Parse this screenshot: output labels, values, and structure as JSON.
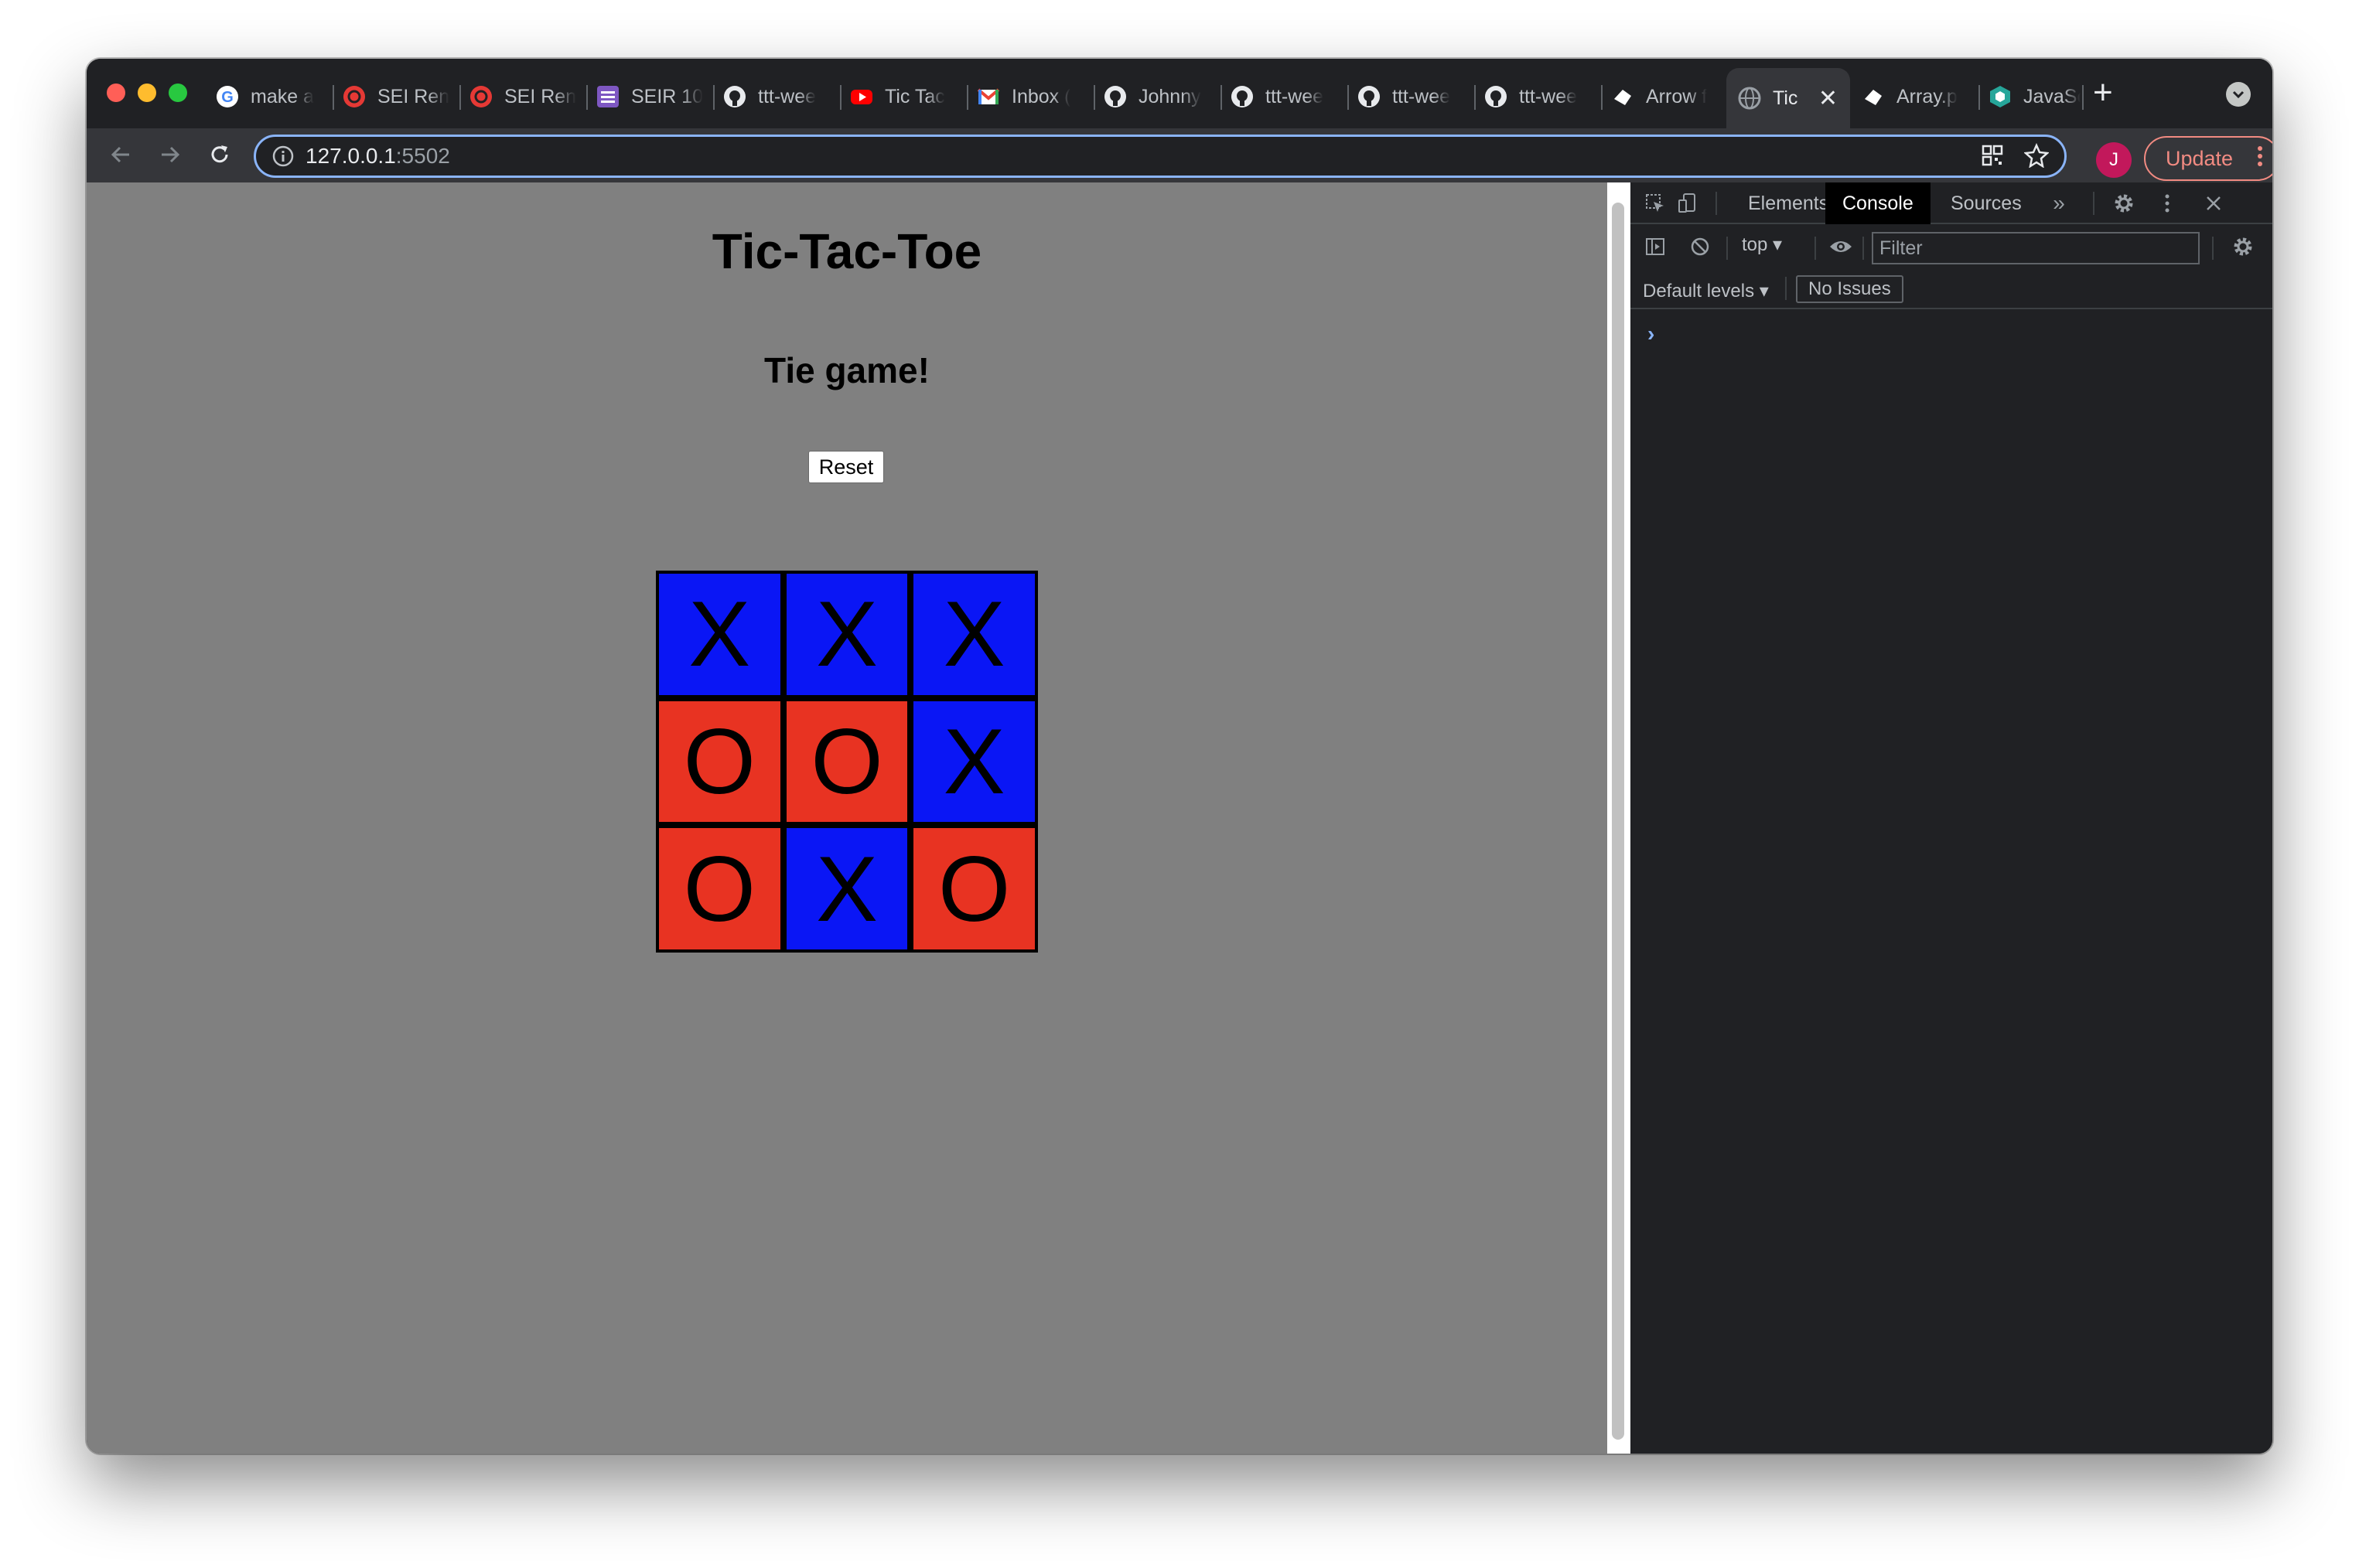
{
  "browser": {
    "tabs": [
      {
        "label": "make a",
        "favicon": "google-icon"
      },
      {
        "label": "SEI Ren",
        "favicon": "ga-icon"
      },
      {
        "label": "SEI Ren",
        "favicon": "ga-icon"
      },
      {
        "label": "SEIR 10",
        "favicon": "list-icon"
      },
      {
        "label": "ttt-wee",
        "favicon": "github-icon"
      },
      {
        "label": "Tic Tac",
        "favicon": "youtube-icon"
      },
      {
        "label": "Inbox (",
        "favicon": "gmail-icon"
      },
      {
        "label": "Johnny",
        "favicon": "github-icon"
      },
      {
        "label": "ttt-wee",
        "favicon": "github-icon"
      },
      {
        "label": "ttt-wee",
        "favicon": "github-icon"
      },
      {
        "label": "ttt-wee",
        "favicon": "github-icon"
      },
      {
        "label": "Arrow f",
        "favicon": "codecademy-icon"
      },
      {
        "label": "Tic",
        "favicon": "globe-icon",
        "active": true
      },
      {
        "label": "Array.p",
        "favicon": "codecademy-icon"
      },
      {
        "label": "JavaSc",
        "favicon": "hexagon-icon"
      }
    ],
    "url_host": "127.0.0.1",
    "url_port": ":5502",
    "profile_initial": "J",
    "update_label": "Update"
  },
  "page": {
    "title": "Tic-Tac-Toe",
    "status": "Tie game!",
    "reset_label": "Reset",
    "board": [
      "X",
      "X",
      "X",
      "O",
      "O",
      "X",
      "O",
      "X",
      "O"
    ],
    "colors": {
      "X": "#0a16f5",
      "O": "#e83322",
      "background": "#808080"
    }
  },
  "devtools": {
    "tabs": [
      "Elements",
      "Console",
      "Sources"
    ],
    "active_tab": "Console",
    "context": "top",
    "filter_placeholder": "Filter",
    "levels_label": "Default levels",
    "issues_label": "No Issues",
    "prompt": "›"
  }
}
